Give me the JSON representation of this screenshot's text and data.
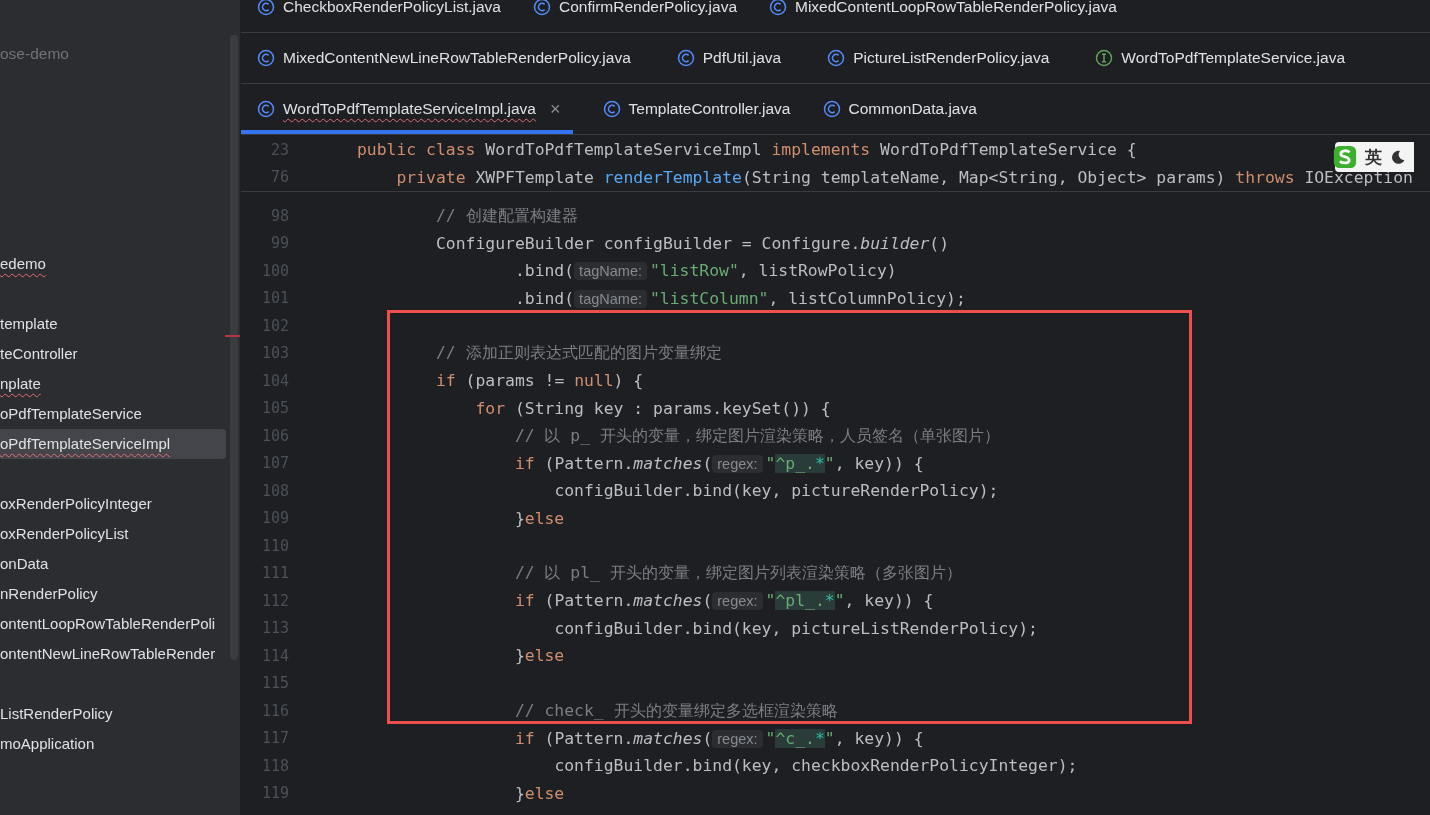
{
  "project": {
    "name": "ose-demo",
    "groups": [
      {
        "items": [
          {
            "label": "edemo",
            "selected": false,
            "error": true
          }
        ]
      },
      {
        "items": [
          {
            "label": "template",
            "selected": false,
            "error": false
          },
          {
            "label": "teController",
            "selected": false,
            "error": false
          },
          {
            "label": "nplate",
            "selected": false,
            "error": true
          },
          {
            "label": "oPdfTemplateService",
            "selected": false,
            "error": false
          },
          {
            "label": "oPdfTemplateServiceImpl",
            "selected": true,
            "error": true
          }
        ]
      },
      {
        "items": [
          {
            "label": "oxRenderPolicyInteger",
            "selected": false,
            "error": false
          },
          {
            "label": "oxRenderPolicyList",
            "selected": false,
            "error": false
          },
          {
            "label": "onData",
            "selected": false,
            "error": false
          },
          {
            "label": "nRenderPolicy",
            "selected": false,
            "error": false
          },
          {
            "label": "ontentLoopRowTableRenderPoli",
            "selected": false,
            "error": false
          },
          {
            "label": "ontentNewLineRowTableRender",
            "selected": false,
            "error": false
          }
        ]
      },
      {
        "items": [
          {
            "label": "ListRenderPolicy",
            "selected": false,
            "error": false
          },
          {
            "label": "moApplication",
            "selected": false,
            "error": false
          }
        ]
      }
    ]
  },
  "tab_rows": [
    [
      {
        "label": "CheckboxRenderPolicyList.java",
        "kind": "class",
        "selected": false,
        "error": false
      },
      {
        "label": "ConfirmRenderPolicy.java",
        "kind": "class",
        "selected": false,
        "error": false
      },
      {
        "label": "MixedContentLoopRowTableRenderPolicy.java",
        "kind": "class",
        "selected": false,
        "error": false
      }
    ],
    [
      {
        "label": "MixedContentNewLineRowTableRenderPolicy.java",
        "kind": "class",
        "selected": false,
        "error": false
      },
      {
        "label": "PdfUtil.java",
        "kind": "class",
        "selected": false,
        "error": false
      },
      {
        "label": "PictureListRenderPolicy.java",
        "kind": "class",
        "selected": false,
        "error": false
      },
      {
        "label": "WordToPdfTemplateService.java",
        "kind": "interface",
        "selected": false,
        "error": false
      }
    ],
    [
      {
        "label": "WordToPdfTemplateServiceImpl.java",
        "kind": "class",
        "selected": true,
        "error": true,
        "close": "×"
      },
      {
        "label": "TemplateController.java",
        "kind": "class",
        "selected": false,
        "error": false
      },
      {
        "label": "CommonData.java",
        "kind": "class",
        "selected": false,
        "error": false
      }
    ]
  ],
  "sticky_lines": [
    {
      "number": "23",
      "tokens": [
        {
          "text": "public class ",
          "kind": "keyword"
        },
        {
          "text": "WordToPdfTemplateServiceImpl ",
          "kind": "plain"
        },
        {
          "text": "implements ",
          "kind": "keyword"
        },
        {
          "text": "WordToPdfTemplateService {",
          "kind": "plain"
        }
      ]
    },
    {
      "number": "76",
      "tokens": [
        {
          "text": "    private ",
          "kind": "keyword"
        },
        {
          "text": "XWPFTemplate ",
          "kind": "plain"
        },
        {
          "text": "renderTemplate",
          "kind": "declaration"
        },
        {
          "text": "(String templateName, Map<String, Object> params) ",
          "kind": "plain"
        },
        {
          "text": "throws ",
          "kind": "keyword"
        },
        {
          "text": "IOException",
          "kind": "plain"
        }
      ]
    }
  ],
  "lines": [
    {
      "number": "98",
      "tokens": [
        {
          "text": "        // 创建配置构建器",
          "kind": "comment"
        }
      ]
    },
    {
      "number": "99",
      "tokens": [
        {
          "text": "        ConfigureBuilder configBuilder = Configure.",
          "kind": "plain"
        },
        {
          "text": "builder",
          "kind": "static"
        },
        {
          "text": "()",
          "kind": "plain"
        }
      ]
    },
    {
      "number": "100",
      "tokens": [
        {
          "text": "                .bind(",
          "kind": "plain"
        },
        {
          "text": "tagName:",
          "kind": "hint"
        },
        {
          "text": "\"listRow\"",
          "kind": "string"
        },
        {
          "text": ", listRowPolicy)",
          "kind": "plain"
        }
      ]
    },
    {
      "number": "101",
      "tokens": [
        {
          "text": "                .bind(",
          "kind": "plain"
        },
        {
          "text": "tagName:",
          "kind": "hint"
        },
        {
          "text": "\"listColumn\"",
          "kind": "string"
        },
        {
          "text": ", listColumnPolicy);",
          "kind": "plain"
        }
      ]
    },
    {
      "number": "102"
    },
    {
      "number": "103",
      "tokens": [
        {
          "text": "        // 添加正则表达式匹配的图片变量绑定",
          "kind": "comment"
        }
      ]
    },
    {
      "number": "104",
      "tokens": [
        {
          "text": "        if",
          "kind": "keyword"
        },
        {
          "text": " (params != ",
          "kind": "plain"
        },
        {
          "text": "null",
          "kind": "keyword"
        },
        {
          "text": ") {",
          "kind": "plain"
        }
      ]
    },
    {
      "number": "105",
      "tokens": [
        {
          "text": "            for",
          "kind": "keyword"
        },
        {
          "text": " (String key : params.keySet()) {",
          "kind": "plain"
        }
      ]
    },
    {
      "number": "106",
      "tokens": [
        {
          "text": "                // 以 p_ 开头的变量，绑定图片渲染策略，人员签名（单张图片）",
          "kind": "comment"
        }
      ]
    },
    {
      "number": "107",
      "tokens": [
        {
          "text": "                if",
          "kind": "keyword"
        },
        {
          "text": " (Pattern.",
          "kind": "plain"
        },
        {
          "text": "matches",
          "kind": "static"
        },
        {
          "text": "(",
          "kind": "plain"
        },
        {
          "text": "regex:",
          "kind": "hint"
        },
        {
          "text": "\"",
          "kind": "string"
        },
        {
          "text": "^p_.",
          "kind": "regex"
        },
        {
          "text": "*",
          "kind": "regex_operator"
        },
        {
          "text": "\"",
          "kind": "string"
        },
        {
          "text": ", key)) {",
          "kind": "plain"
        }
      ]
    },
    {
      "number": "108",
      "tokens": [
        {
          "text": "                    configBuilder.bind(key, pictureRenderPolicy);",
          "kind": "plain"
        }
      ]
    },
    {
      "number": "109",
      "tokens": [
        {
          "text": "                }",
          "kind": "plain"
        },
        {
          "text": "else",
          "kind": "keyword"
        }
      ]
    },
    {
      "number": "110"
    },
    {
      "number": "111",
      "tokens": [
        {
          "text": "                // 以 pl_ 开头的变量，绑定图片列表渲染策略（多张图片）",
          "kind": "comment"
        }
      ]
    },
    {
      "number": "112",
      "tokens": [
        {
          "text": "                if",
          "kind": "keyword"
        },
        {
          "text": " (Pattern.",
          "kind": "plain"
        },
        {
          "text": "matches",
          "kind": "static"
        },
        {
          "text": "(",
          "kind": "plain"
        },
        {
          "text": "regex:",
          "kind": "hint"
        },
        {
          "text": "\"",
          "kind": "string"
        },
        {
          "text": "^pl_.",
          "kind": "regex"
        },
        {
          "text": "*",
          "kind": "regex_operator"
        },
        {
          "text": "\"",
          "kind": "string"
        },
        {
          "text": ", key)) {",
          "kind": "plain"
        }
      ]
    },
    {
      "number": "113",
      "tokens": [
        {
          "text": "                    configBuilder.bind(key, pictureListRenderPolicy);",
          "kind": "plain"
        }
      ]
    },
    {
      "number": "114",
      "tokens": [
        {
          "text": "                }",
          "kind": "plain"
        },
        {
          "text": "else",
          "kind": "keyword"
        }
      ]
    },
    {
      "number": "115"
    },
    {
      "number": "116",
      "tokens": [
        {
          "text": "                // check_ 开头的变量绑定多选框渲染策略",
          "kind": "comment"
        }
      ]
    },
    {
      "number": "117",
      "tokens": [
        {
          "text": "                if",
          "kind": "keyword"
        },
        {
          "text": " (Pattern.",
          "kind": "plain"
        },
        {
          "text": "matches",
          "kind": "static"
        },
        {
          "text": "(",
          "kind": "plain"
        },
        {
          "text": "regex:",
          "kind": "hint"
        },
        {
          "text": "\"",
          "kind": "string"
        },
        {
          "text": "^c_.",
          "kind": "regex"
        },
        {
          "text": "*",
          "kind": "regex_operator"
        },
        {
          "text": "\"",
          "kind": "string"
        },
        {
          "text": ", key)) {",
          "kind": "plain"
        }
      ]
    },
    {
      "number": "118",
      "tokens": [
        {
          "text": "                    configBuilder.bind(key, checkboxRenderPolicyInteger);",
          "kind": "plain"
        }
      ]
    },
    {
      "number": "119",
      "tokens": [
        {
          "text": "                }",
          "kind": "plain"
        },
        {
          "text": "else",
          "kind": "keyword"
        }
      ]
    }
  ],
  "ime": {
    "label": "英"
  }
}
